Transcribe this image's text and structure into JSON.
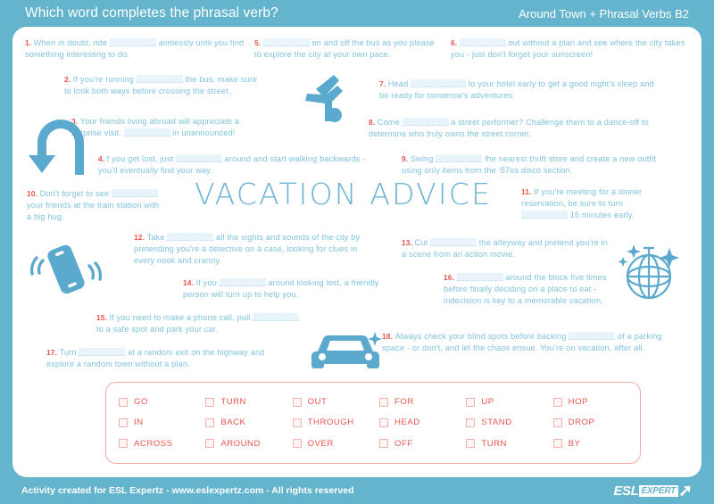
{
  "header": {
    "title": "Which word completes the phrasal verb?",
    "subtitle": "Around Town + Phrasal Verbs B2"
  },
  "center_title": "VACATION ADVICE",
  "questions": [
    {
      "num": "1.",
      "before": "When in doubt, ride ",
      "after": " aimlessly until you find something interesting to do."
    },
    {
      "num": "2.",
      "before": "If you're running ",
      "after": " the bus, make sure to look both ways before crossing the street.."
    },
    {
      "num": "3.",
      "before": "Your friends living abroad will appreciate a surprise visit. ",
      "after": " in unannounced!"
    },
    {
      "num": "4.",
      "before": "f you get lost, just ",
      "after": " around and start walking backwards - you'll eventually find your way."
    },
    {
      "num": "5.",
      "before": "",
      "after": " on and off the bus as you please to explore the city at your own pace."
    },
    {
      "num": "6.",
      "before": "",
      "after": " out without a plan and see where the city takes you - just don't forget your sunscreen!"
    },
    {
      "num": "7.",
      "before": "Head ",
      "after": " to your hotel early to get a good night's sleep and be ready for tomorrow's adventures."
    },
    {
      "num": "8.",
      "before": "Come ",
      "after": " a street performer? Challenge them to a dance-off to determine who truly owns the street corner."
    },
    {
      "num": "9.",
      "before": "Swing ",
      "after": " the nearest thrift store and create a new outfit using only items from the 'б7os disco section."
    },
    {
      "num": "10.",
      "before": "Don't forget to see ",
      "after": " your friends at the train station with a big hug."
    },
    {
      "num": "11.",
      "before": "If you're meeting for a dinner reservation, be sure to turn ",
      "after": " 15 minutes early."
    },
    {
      "num": "12.",
      "before": "Take ",
      "after": " all the sights and sounds of the city by pretending you're a detective on a case, looking for clues in every nook and cranny."
    },
    {
      "num": "13.",
      "before": "Cut ",
      "after": " the alleyway and pretend you're in a scene from an action movie."
    },
    {
      "num": "14.",
      "before": "If you ",
      "after": " around looking lost, a friendly person will turn up to help you."
    },
    {
      "num": "15.",
      "before": "If you need to make a phone call, pull ",
      "after": " to a safe spot and park your car."
    },
    {
      "num": "16.",
      "before": "",
      "after": " around the block five times before finally deciding on a place to eat - indecision is key to a memorable vacation."
    },
    {
      "num": "17.",
      "before": "Turn ",
      "after": " at a random exit on the highway and explore a random town without a plan."
    },
    {
      "num": "18.",
      "before": "Always check your blind spots before backing ",
      "after": " of a parking space - or don't, and let the chaos ensue. You're on vacation, after all."
    }
  ],
  "word_bank": [
    "GO",
    "TURN",
    "OUT",
    "FOR",
    "UP",
    "HOP",
    "IN",
    "BACK",
    "THROUGH",
    "HEAD",
    "STAND",
    "DROP",
    "ACROSS",
    "AROUND",
    "OVER",
    "OFF",
    "TURN",
    "BY"
  ],
  "footer": {
    "credit": "Activity created for ESL Expertz - www.eslexpertz.com - All rights reserved",
    "logo_primary": "ESL",
    "logo_secondary": "EXPERT"
  },
  "colors": {
    "background": "#64b4cd",
    "card": "#ffffff",
    "body_text": "#7fc3dd",
    "number": "#e8554e",
    "wordbank_text": "#e8554e",
    "icon": "#5ba9cc"
  }
}
